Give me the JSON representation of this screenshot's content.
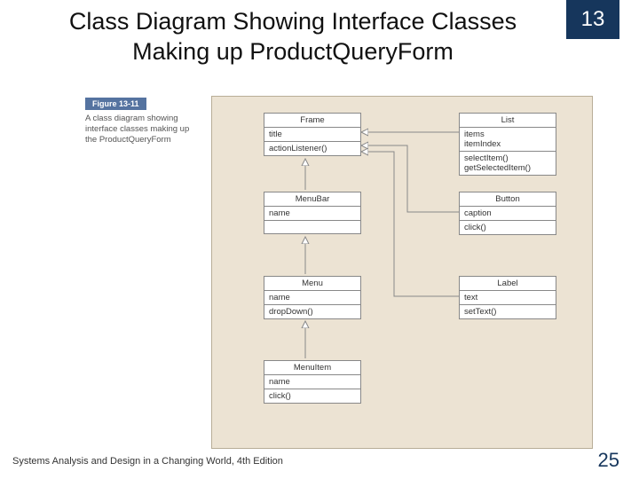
{
  "header": {
    "title": "Class Diagram Showing Interface Classes Making up ProductQueryForm",
    "chapter": "13"
  },
  "figure": {
    "label": "Figure 13-11",
    "caption": "A class diagram showing interface classes making up the ProductQueryForm"
  },
  "uml": {
    "frame": {
      "name": "Frame",
      "attrs": "title",
      "ops": "actionListener()"
    },
    "list": {
      "name": "List",
      "attrs": "items\nitemIndex",
      "ops": "selectItem()\ngetSelectedItem()"
    },
    "menubar": {
      "name": "MenuBar",
      "attrs": "name",
      "ops": ""
    },
    "button": {
      "name": "Button",
      "attrs": "caption",
      "ops": "click()"
    },
    "menu": {
      "name": "Menu",
      "attrs": "name",
      "ops": "dropDown()"
    },
    "label": {
      "name": "Label",
      "attrs": "text",
      "ops": "setText()"
    },
    "menuitem": {
      "name": "MenuItem",
      "attrs": "name",
      "ops": "click()"
    }
  },
  "footer": {
    "left": "Systems Analysis and Design in a Changing World, 4th Edition",
    "page": "25"
  }
}
